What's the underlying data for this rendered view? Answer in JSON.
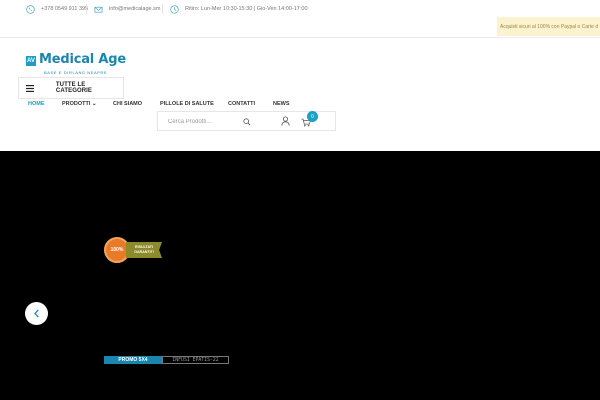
{
  "topbar": {
    "phone": "+378 0549 911 395",
    "email": "info@medicalage.sm",
    "hours": "Ritiro: Lun-Mer 10:30-15:30  |  Gio-Ven 14:00-17:00",
    "promo": "Acquisti sicuri al 100% con Paypal o Carte d"
  },
  "logo": {
    "mark": "AV",
    "name": "Medical Age",
    "tagline": "BASE E DIRLAND NEAPRE"
  },
  "categories": {
    "label": "TUTTE LE CATEGORIE"
  },
  "nav": {
    "items": [
      {
        "label": "HOME"
      },
      {
        "label": "PRODOTTI ⌄"
      },
      {
        "label": "CHI SIAMO"
      },
      {
        "label": "PILLOLE DI SALUTE"
      },
      {
        "label": "CONTATTI"
      },
      {
        "label": "NEWS"
      }
    ]
  },
  "search": {
    "placeholder": "Cerca Prodotti..."
  },
  "cart": {
    "count": "0"
  },
  "hero": {
    "seal_text": "100%",
    "ribbon_text": "RISULTATI GARANTITI",
    "promo_label": "PROMO 5X4",
    "promo_code": "INFUSI EPATIS-22"
  },
  "colors": {
    "accent": "#1ba0c4",
    "brand": "#1a86b0",
    "hero_bg": "#000000"
  }
}
